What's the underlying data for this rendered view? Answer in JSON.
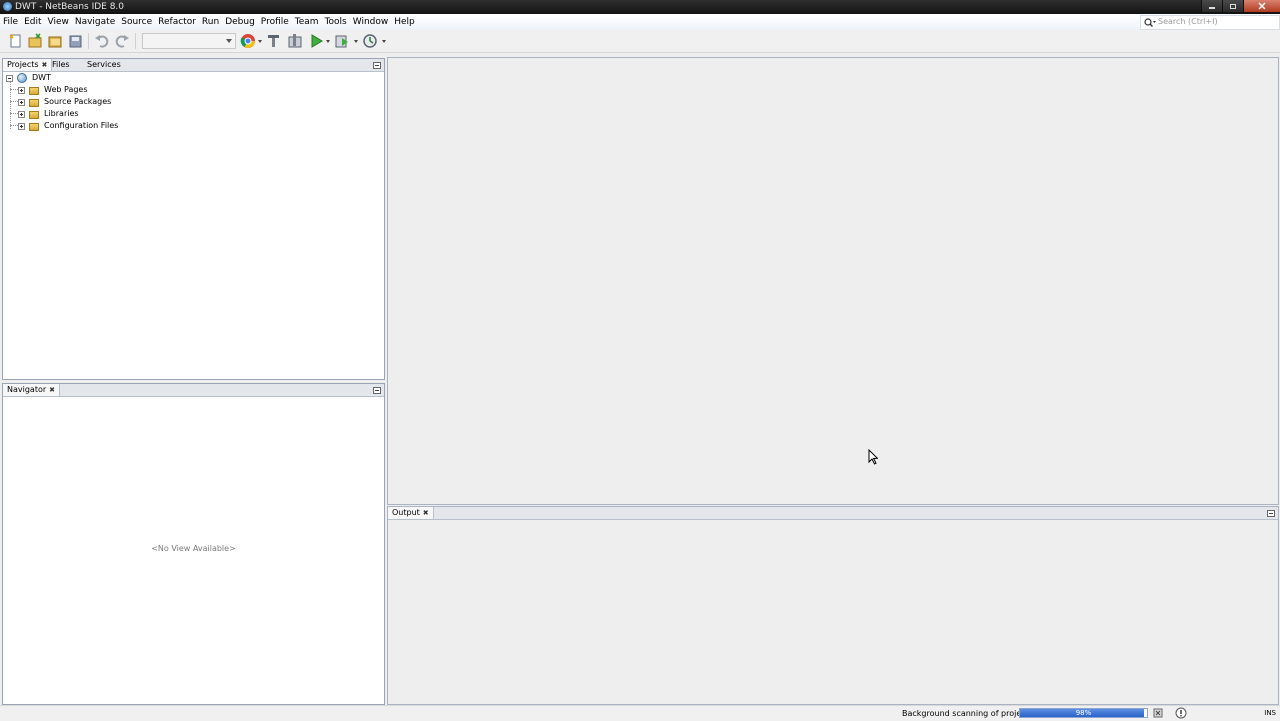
{
  "window": {
    "title": "DWT - NetBeans IDE 8.0"
  },
  "menu": {
    "items": [
      "File",
      "Edit",
      "View",
      "Navigate",
      "Source",
      "Refactor",
      "Run",
      "Debug",
      "Profile",
      "Team",
      "Tools",
      "Window",
      "Help"
    ],
    "search_placeholder": "Search (Ctrl+I)"
  },
  "toolbar": {
    "buttons": [
      "new-file",
      "new-project",
      "open-project",
      "save-all",
      "undo",
      "redo",
      "browser",
      "clean-build",
      "build",
      "run",
      "debug",
      "profile"
    ],
    "config_value": ""
  },
  "projects_panel": {
    "tabs": [
      "Projects",
      "Files",
      "Services"
    ],
    "active_tab": "Projects",
    "root": "DWT",
    "nodes": [
      "Web Pages",
      "Source Packages",
      "Libraries",
      "Configuration Files"
    ]
  },
  "navigator_panel": {
    "tab": "Navigator",
    "empty_text": "<No View Available>"
  },
  "output_panel": {
    "tab": "Output"
  },
  "status": {
    "message": "Background scanning of projects...",
    "progress_label": "98%",
    "progress_value": 0.98,
    "mode": "INS"
  },
  "colors": {
    "progress": "#2f6bd0",
    "panel_border": "#9aa4b4"
  }
}
